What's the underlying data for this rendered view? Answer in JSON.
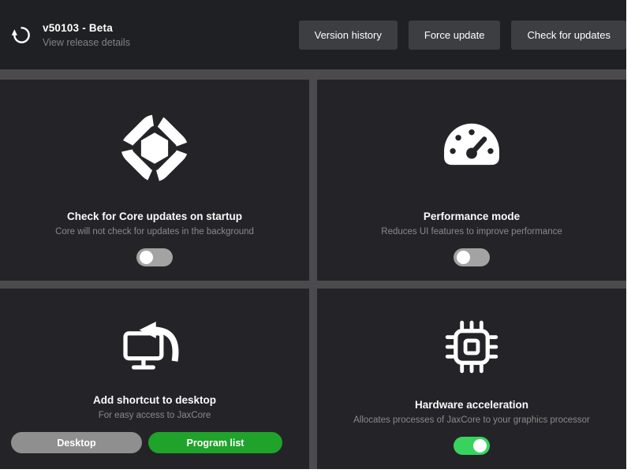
{
  "header": {
    "version_label": "v50103 - Beta",
    "release_link": "View release details",
    "buttons": {
      "version_history": "Version history",
      "force_update": "Force update",
      "check_for_updates": "Check for updates"
    }
  },
  "cards": [
    {
      "icon": "core-logo-icon",
      "title": "Check for Core updates on startup",
      "subtitle": "Core will not check for updates in the background",
      "control": "toggle",
      "enabled": false
    },
    {
      "icon": "speedometer-icon",
      "title": "Performance mode",
      "subtitle": "Reduces UI features to improve performance",
      "control": "toggle",
      "enabled": false
    },
    {
      "icon": "desktop-shortcut-icon",
      "title": "Add shortcut to desktop",
      "subtitle": "For easy access to JaxCore",
      "control": "buttons",
      "buttons": {
        "desktop": "Desktop",
        "program_list": "Program list"
      }
    },
    {
      "icon": "cpu-chip-icon",
      "title": "Hardware acceleration",
      "subtitle": "Allocates processes of JaxCore to your graphics processor",
      "control": "toggle",
      "enabled": true
    }
  ],
  "colors": {
    "toggle_on_green": "#38d35f",
    "toggle_off_gray": "#a3a3a3",
    "program_list_green": "#1fa32a",
    "desktop_button_gray": "#8f8f8f",
    "header_button_bg": "#3d3e42"
  }
}
